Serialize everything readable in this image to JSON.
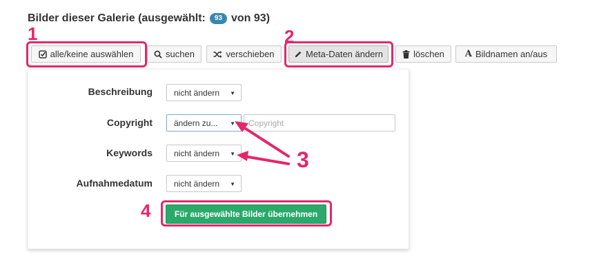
{
  "heading": {
    "prefix": "Bilder dieser Galerie (ausgewählt:",
    "selected_count": "93",
    "suffix": "von 93)"
  },
  "toolbar": {
    "select_all": {
      "label": "alle/keine auswählen",
      "icon": "checkbox-check-icon"
    },
    "search": {
      "label": "suchen",
      "icon": "search-icon"
    },
    "move": {
      "label": "verschieben",
      "icon": "shuffle-icon"
    },
    "meta": {
      "label": "Meta-Daten ändern",
      "icon": "pencil-icon"
    },
    "delete": {
      "label": "löschen",
      "icon": "trash-icon"
    },
    "names": {
      "label": "Bildnamen an/aus",
      "icon": "text-a-icon",
      "icon_glyph": "A"
    }
  },
  "form": {
    "rows": [
      {
        "label": "Beschreibung",
        "select_value": "nicht ändern"
      },
      {
        "label": "Copyright",
        "select_value": "ändern zu...",
        "input_placeholder": "Copyright"
      },
      {
        "label": "Keywords",
        "select_value": "nicht ändern"
      },
      {
        "label": "Aufnahmedatum",
        "select_value": "nicht ändern"
      }
    ],
    "submit_label": "Für ausgewählte Bilder übernehmen"
  },
  "annotations": {
    "step1": "1",
    "step2": "2",
    "step3": "3",
    "step4": "4",
    "color": "#e5266b"
  },
  "colors": {
    "badge": "#3a87ad",
    "submit": "#2ba96b"
  }
}
